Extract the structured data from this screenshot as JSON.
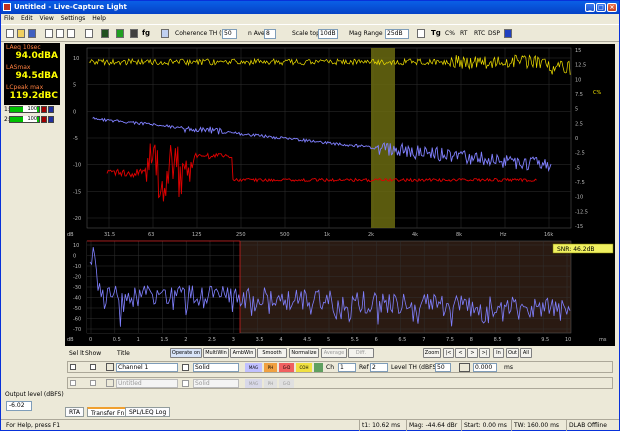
{
  "window": {
    "title": "Untitled - Live-Capture Light"
  },
  "menu": [
    "File",
    "Edit",
    "View",
    "Settings",
    "Help"
  ],
  "toolbar": {
    "coherence_label": "Coherence TH (%)",
    "coherence_value": "50",
    "navg_label": "n Ave",
    "navg_value": "8",
    "scale_label": "Scale top",
    "scale_value": "10dB",
    "mag_label": "Mag Range",
    "mag_value": "25dB",
    "tg": "Tg",
    "btn_c": "C%",
    "rt": "RT",
    "btn_rtc": "RTC",
    "btn_dsp": "DSP"
  },
  "meters": [
    {
      "label": "LAeq 10sec",
      "value": "94.0dBA"
    },
    {
      "label": "LASmax",
      "value": "94.5dBA"
    },
    {
      "label": "LCpeak max",
      "value": "119.2dBC"
    }
  ],
  "channels_left": [
    {
      "num": "1:",
      "val": "100"
    },
    {
      "num": "2:",
      "val": "100"
    }
  ],
  "top_plot": {
    "y_left": [
      "10",
      "5",
      "0",
      "-5",
      "-10",
      "-15",
      "-20"
    ],
    "y_right": [
      "15",
      "12.5",
      "10",
      "7.5",
      "5",
      "2.5",
      "0",
      "-2.5",
      "-5",
      "-7.5",
      "-10",
      "-12.5",
      "-15"
    ],
    "x_ticks": [
      "31.5",
      "63",
      "125",
      "250",
      "500",
      "1k",
      "2k",
      "4k",
      "8k",
      "Hz",
      "16k"
    ],
    "x_unit_left": "dB",
    "pct_label": "C%"
  },
  "bottom_plot": {
    "snr": "SNR: 46.2dB",
    "y_left": [
      "10",
      "0",
      "-10",
      "-20",
      "-30",
      "-40",
      "-50",
      "-60",
      "-70"
    ],
    "x_ticks": [
      "0",
      "0.5",
      "1",
      "1.5",
      "2",
      "2.5",
      "3",
      "3.5",
      "4",
      "4.5",
      "5",
      "5.5",
      "6",
      "6.5",
      "7",
      "7.5",
      "8",
      "8.5",
      "9",
      "9.5",
      "10"
    ],
    "x_unit": "ms",
    "y_unit": "dB"
  },
  "controls": {
    "sel": "Sel lt",
    "show": "Show",
    "title": "Title",
    "buttons": [
      "Operate on",
      "MultiWin",
      "AmbWin",
      "Smooth",
      "Normalize",
      "Average",
      "Diff."
    ],
    "zoom": "Zoom",
    "nav": [
      "|<",
      "<",
      ">",
      ">|",
      "In",
      "Out",
      "All"
    ]
  },
  "channel_rows": [
    {
      "name": "Channel 1",
      "style": "Solid",
      "ch": "1",
      "ref": "2",
      "lvl_label": "Level TH (dBFS)",
      "lvl": "50",
      "delay": "0.000",
      "ms": "ms",
      "tags": [
        "MAG",
        "PH",
        "G-D",
        "COH"
      ]
    },
    {
      "name": "Untitled",
      "style": "Solid",
      "tags": [
        "MAG",
        "PH",
        "G-D"
      ]
    }
  ],
  "output_level": {
    "label": "Output level (dBFS)",
    "value": "-6.02"
  },
  "tabs": [
    "RTA",
    "Transfer Fn",
    "SPL/LEQ Log"
  ],
  "status": {
    "help": "For Help, press F1",
    "t1": "t1: 10.62 ms",
    "mag": "Mag: -44.64 dBr",
    "start": "Start: 0.00 ms",
    "tw": "TW: 160.00 ms",
    "dlab": "DLAB Offline"
  },
  "colors": {
    "yellow": "#f0e000",
    "blue": "#8080ff",
    "red": "#e00000",
    "band": "#6a6a10"
  }
}
